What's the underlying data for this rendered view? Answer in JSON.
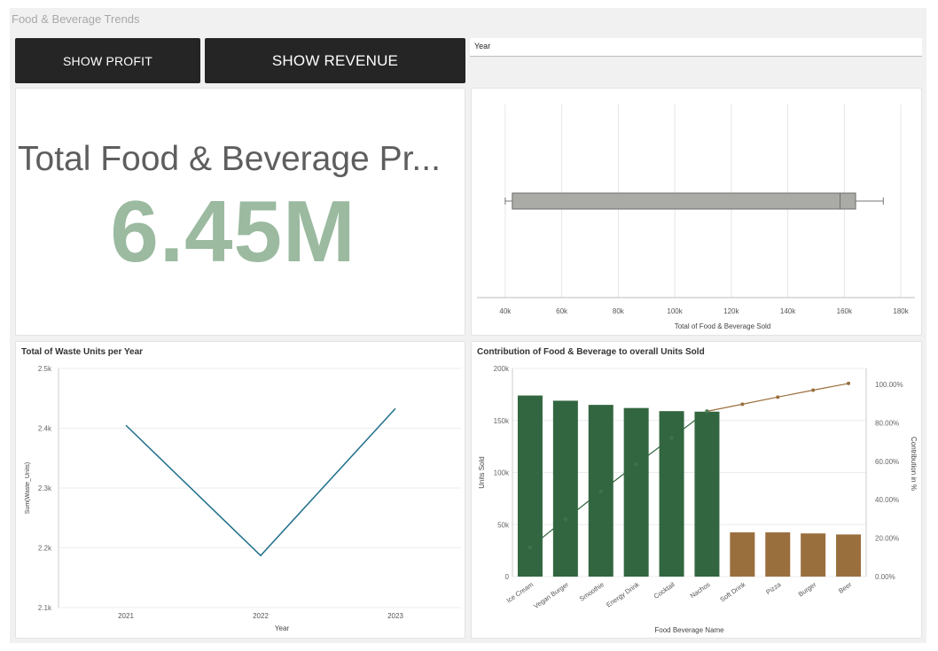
{
  "dashboard": {
    "title": "Food & Beverage Trends"
  },
  "buttons": {
    "profit_label": "SHOW PROFIT",
    "revenue_label": "SHOW REVENUE"
  },
  "filter": {
    "label": "Year"
  },
  "kpi": {
    "label": "Total Food & Beverage Pr...",
    "value": "6.45M"
  },
  "colors": {
    "kpi_value": "#9bbaa0",
    "bar_top": "#326640",
    "bar_other": "#9a6f3e",
    "line": "#1f6f8b",
    "button_bg": "#252525"
  },
  "chart_data": [
    {
      "type": "box",
      "title": "",
      "xlabel": "Total of Food & Beverage Sold",
      "xlim": [
        30000,
        185000
      ],
      "xticks": [
        40000,
        60000,
        80000,
        100000,
        120000,
        140000,
        160000,
        180000
      ],
      "xtick_labels": [
        "40k",
        "60k",
        "80k",
        "100k",
        "120k",
        "140k",
        "160k",
        "180k"
      ],
      "box": {
        "min": 40000,
        "q1": 42500,
        "median": 158500,
        "q3": 164000,
        "max": 173800
      },
      "grid": true
    },
    {
      "type": "line",
      "title": "Total of Waste Units per Year",
      "xlabel": "Year",
      "ylabel": "Sum(Waste_Units)",
      "x": [
        "2021",
        "2022",
        "2023"
      ],
      "values": [
        2405,
        2187,
        2433
      ],
      "ylim": [
        2100,
        2500
      ],
      "yticks": [
        2100,
        2200,
        2300,
        2400,
        2500
      ],
      "ytick_labels": [
        "2.1k",
        "2.2k",
        "2.3k",
        "2.4k",
        "2.5k"
      ],
      "grid": true
    },
    {
      "type": "bar",
      "title": "Contribution of Food & Beverage to overall Units Sold",
      "xlabel": "Food Beverage Name",
      "ylabel": "Units Sold",
      "y2label": "Contribution in %",
      "categories": [
        "Ice Cream",
        "Vegan Burger",
        "Smoothie",
        "Energy Drink",
        "Cocktail",
        "Nachos",
        "Soft Drink",
        "Pizza",
        "Burger",
        "Beer"
      ],
      "values": [
        174000,
        169000,
        165000,
        162000,
        159000,
        158500,
        42500,
        42500,
        41500,
        40500
      ],
      "cumulative_percent": [
        15.2,
        29.9,
        44.3,
        58.4,
        72.2,
        86.0,
        89.7,
        93.4,
        97.0,
        100.5
      ],
      "top_group_count": 6,
      "ylim": [
        0,
        200000
      ],
      "yticks": [
        0,
        50000,
        100000,
        150000,
        200000
      ],
      "ytick_labels": [
        "0",
        "50k",
        "100k",
        "150k",
        "200k"
      ],
      "y2ticks": [
        0,
        20,
        40,
        60,
        80,
        100
      ],
      "y2tick_labels": [
        "0.00%",
        "20.00%",
        "40.00%",
        "60.00%",
        "80.00%",
        "100.00%"
      ],
      "grid": true
    }
  ]
}
